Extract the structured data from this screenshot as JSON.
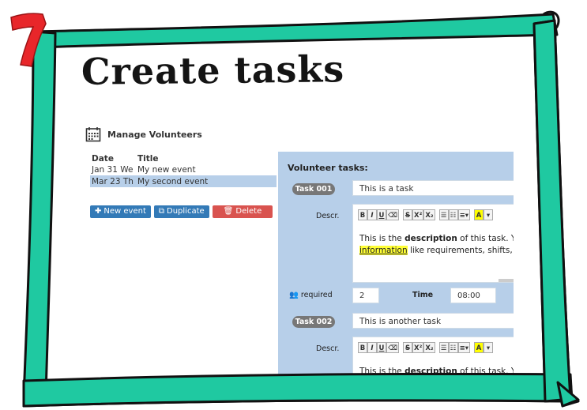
{
  "slide": {
    "title": "Create tasks",
    "step_number": "7"
  },
  "app": {
    "title": "Manage Volunteers",
    "table": {
      "headers": [
        "Date",
        "Title"
      ],
      "rows": [
        {
          "date": "Jan 31 We",
          "title": "My new event",
          "selected": false
        },
        {
          "date": "Mar 23 Th",
          "title": "My second event",
          "selected": true
        }
      ]
    },
    "buttons": {
      "new_event": "New event",
      "duplicate": "Duplicate",
      "delete": "Delete"
    },
    "tasks_panel": {
      "heading": "Volunteer tasks:",
      "tasks": [
        {
          "badge": "Task 001",
          "title_value": "This is a task",
          "descr_label": "Descr.",
          "desc_line1_pre": "This is the ",
          "desc_line1_bold": "description",
          "desc_line1_post": " of this task. You",
          "desc_line2_mark": "information",
          "desc_line2_post": " like requirements, shifts, ",
          "required_label": "required",
          "required_value": "2",
          "time_label": "Time",
          "time_value": "08:00"
        },
        {
          "badge": "Task 002",
          "title_value": "This is another task",
          "descr_label": "Descr.",
          "desc_line1_pre": "This is the ",
          "desc_line1_bold": "description",
          "desc_line1_post": " of this task. You"
        }
      ]
    },
    "toolbar": [
      "B",
      "I",
      "U",
      "⌫",
      "S",
      "X²",
      "X₂",
      "☰",
      "☷",
      "≡▾",
      "A",
      "▾"
    ]
  },
  "colors": {
    "frame_green": "#1fc9a1",
    "frame_outline": "#111111",
    "step_red": "#e8262a",
    "panel_blue": "#b7cfe9",
    "btn_blue": "#337ab7",
    "btn_red": "#d9534f"
  }
}
